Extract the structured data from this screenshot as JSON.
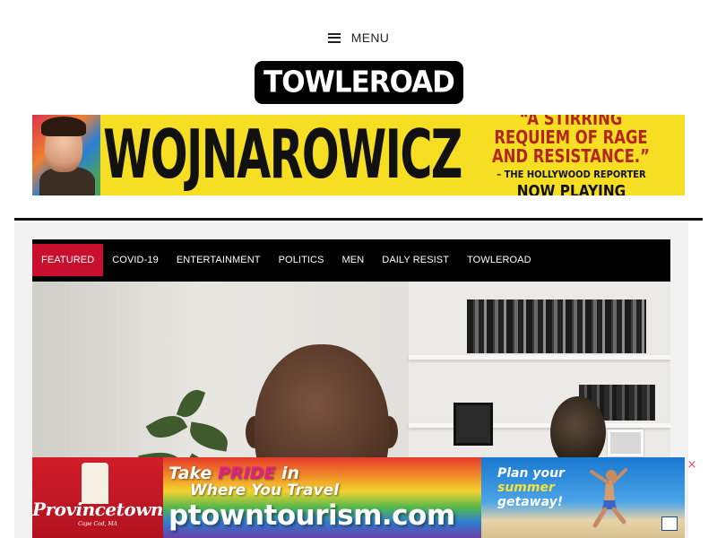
{
  "header": {
    "menu_label": "MENU",
    "logo_text": "TOWLEROAD"
  },
  "top_banner": {
    "title": "WOJNAROWICZ",
    "quote": "“A STIRRING REQUIEM OF RAGE AND RESISTANCE.”",
    "source": "– THE HOLLYWOOD REPORTER",
    "cta": "NOW PLAYING"
  },
  "nav": {
    "tabs": [
      {
        "label": "FEATURED",
        "active": true
      },
      {
        "label": "COVID-19",
        "active": false
      },
      {
        "label": "ENTERTAINMENT",
        "active": false
      },
      {
        "label": "POLITICS",
        "active": false
      },
      {
        "label": "MEN",
        "active": false
      },
      {
        "label": "DAILY RESIST",
        "active": false
      },
      {
        "label": "TOWLEROAD",
        "active": false
      }
    ]
  },
  "bottom_ad": {
    "brand": "Provincetown",
    "brand_sub": "Cape Cod, MA",
    "line1_a": "Take",
    "line1_b": "PRIDE",
    "line1_c": "in",
    "line2": "Where You Travel",
    "url": "ptowntourism.com",
    "plan_a": "Plan your",
    "plan_b": "summer",
    "plan_c": "getaway!",
    "close": "×"
  },
  "colors": {
    "accent": "#c8102e",
    "banner_yellow": "#f6df22",
    "nav_bg": "#000000"
  }
}
